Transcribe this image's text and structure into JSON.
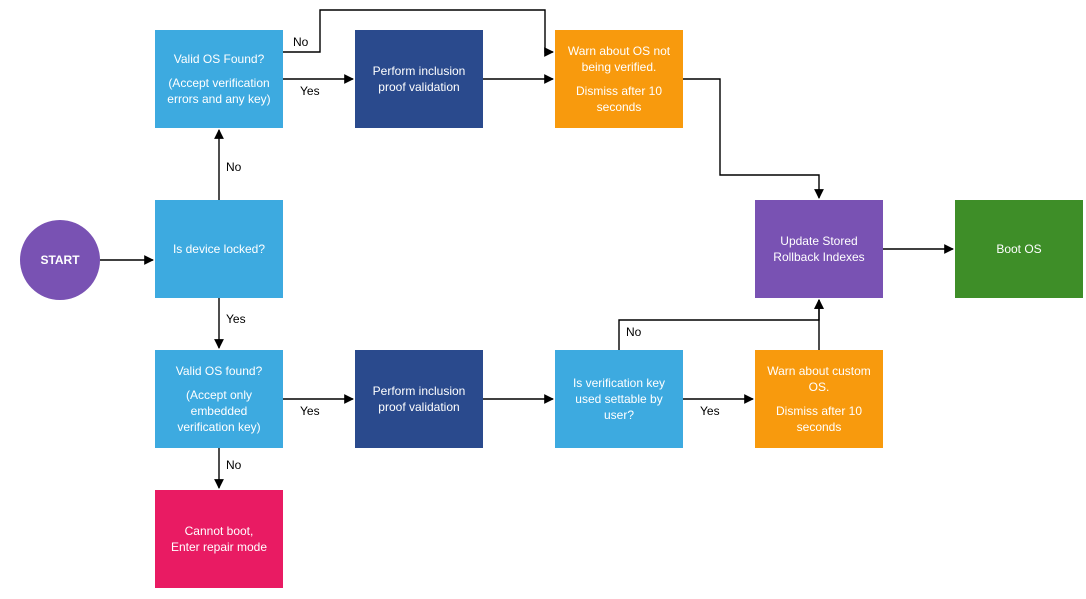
{
  "nodes": {
    "start": {
      "label": "START"
    },
    "locked": {
      "label": "Is device locked?"
    },
    "validAnyKey": {
      "line1": "Valid OS Found?",
      "line2": "(Accept verification errors and any key)"
    },
    "validEmbedded": {
      "line1": "Valid OS found?",
      "line2": "(Accept only embedded verification key)"
    },
    "proofTop": {
      "label": "Perform inclusion proof validation"
    },
    "proofBot": {
      "label": "Perform inclusion proof validation"
    },
    "warnUnverified": {
      "line1": "Warn about OS not being verified.",
      "line2": "Dismiss after 10 seconds"
    },
    "userKey": {
      "label": "Is verification key used settable by user?"
    },
    "warnCustom": {
      "line1": "Warn about custom OS.",
      "line2": "Dismiss after 10 seconds"
    },
    "rollback": {
      "label": "Update Stored Rollback Indexes"
    },
    "boot": {
      "label": "Boot OS"
    },
    "repair": {
      "label": "Cannot boot,\nEnter repair mode"
    }
  },
  "edgeLabels": {
    "lockedNo": "No",
    "lockedYes": "Yes",
    "validAnyNo": "No",
    "validAnyYes": "Yes",
    "validEmbNo": "No",
    "validEmbYes": "Yes",
    "userKeyNo": "No",
    "userKeyYes": "Yes"
  },
  "layout": {
    "col": [
      20,
      155,
      355,
      555,
      755,
      955
    ],
    "row": [
      30,
      200,
      350,
      490
    ],
    "circleY": 220
  },
  "colors": {
    "purple": "#7952b3",
    "blue": "#3daae0",
    "dblue": "#2a4a8d",
    "orange": "#f89a0d",
    "green": "#3e8e28",
    "pink": "#e91b63"
  }
}
